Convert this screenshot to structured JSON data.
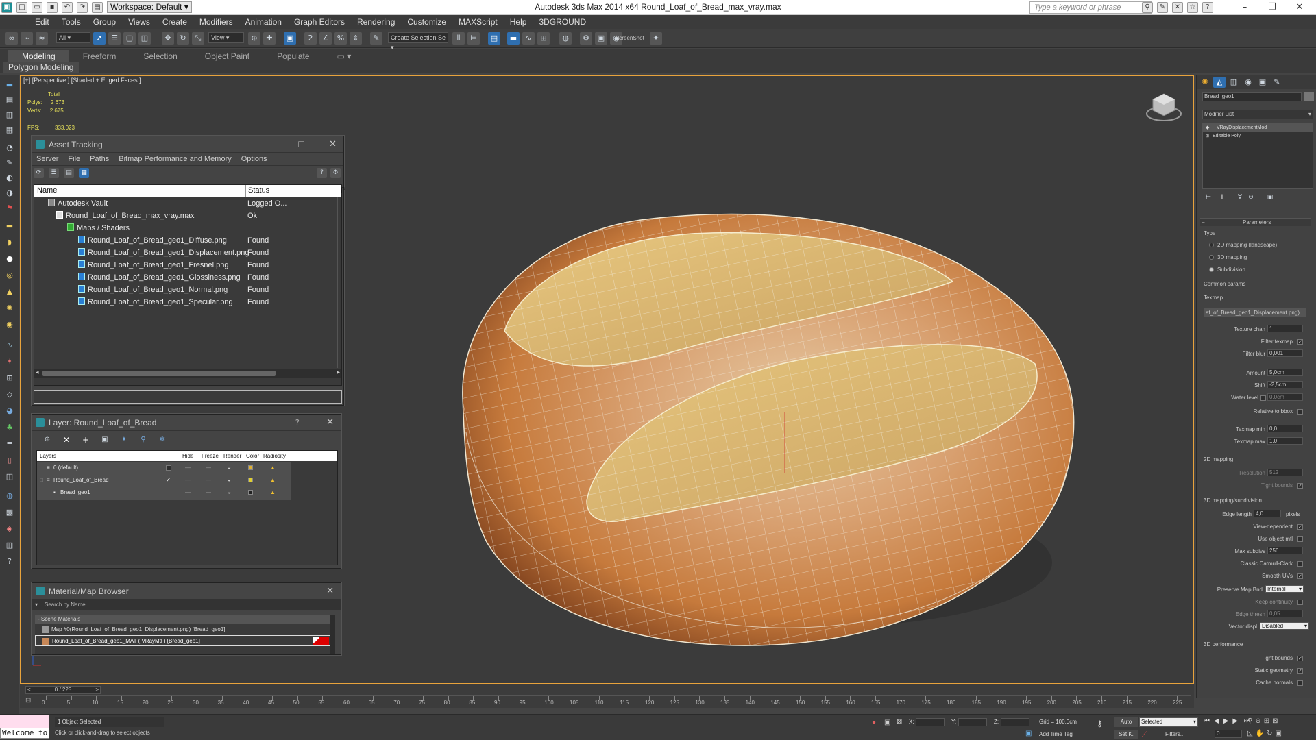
{
  "window": {
    "title": "Autodesk 3ds Max  2014 x64     Round_Loaf_of_Bread_max_vray.max",
    "workspace": "Workspace: Default",
    "search_placeholder": "Type a keyword or phrase"
  },
  "menu": [
    "Edit",
    "Tools",
    "Group",
    "Views",
    "Create",
    "Modifiers",
    "Animation",
    "Graph Editors",
    "Rendering",
    "Customize",
    "MAXScript",
    "Help",
    "3DGROUND"
  ],
  "toolbar": {
    "selection_filter": "All",
    "ref_coord": "View",
    "named_selection": "Create Selection Se",
    "screenshot_label": "ScreenShot"
  },
  "ribbon": {
    "tabs": [
      "Modeling",
      "Freeform",
      "Selection",
      "Object Paint",
      "Populate"
    ],
    "active_tab": "Modeling",
    "sub_label": "Polygon Modeling"
  },
  "viewport": {
    "label": "[+] [Perspective ] [Shaded + Edged Faces ]",
    "stats_header": "Total",
    "polys_label": "Polys:",
    "polys_value": "2 673",
    "verts_label": "Verts:",
    "verts_value": "2 675",
    "fps_label": "FPS:",
    "fps_value": "333,023"
  },
  "asset_tracking": {
    "title": "Asset Tracking",
    "menu": [
      "Server",
      "File",
      "Paths",
      "Bitmap Performance and Memory",
      "Options"
    ],
    "col_name": "Name",
    "col_status": "Status",
    "col_p": "P",
    "rows": [
      {
        "name": "Autodesk Vault",
        "status": "Logged O..."
      },
      {
        "name": "Round_Loaf_of_Bread_max_vray.max",
        "status": "Ok"
      },
      {
        "name": "Maps / Shaders",
        "status": ""
      },
      {
        "name": "Round_Loaf_of_Bread_geo1_Diffuse.png",
        "status": "Found"
      },
      {
        "name": "Round_Loaf_of_Bread_geo1_Displacement.png",
        "status": "Found"
      },
      {
        "name": "Round_Loaf_of_Bread_geo1_Fresnel.png",
        "status": "Found"
      },
      {
        "name": "Round_Loaf_of_Bread_geo1_Glossiness.png",
        "status": "Found"
      },
      {
        "name": "Round_Loaf_of_Bread_geo1_Normal.png",
        "status": "Found"
      },
      {
        "name": "Round_Loaf_of_Bread_geo1_Specular.png",
        "status": "Found"
      }
    ]
  },
  "layer_panel": {
    "title": "Layer: Round_Loaf_of_Bread",
    "help": "?",
    "cols": [
      "Layers",
      "Hide",
      "Freeze",
      "Render",
      "Color",
      "Radiosity"
    ],
    "rows": [
      {
        "name": "0 (default)",
        "color": "#e0b030"
      },
      {
        "name": "Round_Loaf_of_Bread",
        "color": "#e0d030"
      },
      {
        "name": "Bread_geo1",
        "color": "#222222"
      }
    ]
  },
  "material_browser": {
    "title": "Material/Map Browser",
    "search_placeholder": "Search by Name ...",
    "group": "- Scene Materials",
    "items": [
      "Map #0(Round_Loaf_of_Bread_geo1_Displacement.png) [Bread_geo1]",
      "Round_Loaf_of_Bread_geo1_MAT ( VRayMtl ) [Bread_geo1]"
    ]
  },
  "command_panel": {
    "object_name": "Bread_geo1",
    "modifier_list": "Modifier List",
    "stack": [
      "VRayDisplacementMod",
      "Editable Poly"
    ],
    "params_title": "Parameters",
    "type_label": "Type",
    "type_options": [
      "2D mapping (landscape)",
      "3D mapping",
      "Subdivision"
    ],
    "type_selected": 2,
    "common_params": "Common params",
    "texmap_label": "Texmap",
    "texmap_value": "af_of_Bread_geo1_Displacement.png)",
    "texture_chan_label": "Texture chan",
    "texture_chan_value": "1",
    "filter_texmap_label": "Filter texmap",
    "filter_blur_label": "Filter blur",
    "filter_blur_value": "0,001",
    "amount_label": "Amount",
    "amount_value": "5,0cm",
    "shift_label": "Shift",
    "shift_value": "-2,5cm",
    "water_label": "Water level",
    "water_value": "0,0cm",
    "rel_bbox_label": "Relative to bbox",
    "texmap_min_label": "Texmap min",
    "texmap_min_value": "0,0",
    "texmap_max_label": "Texmap max",
    "texmap_max_value": "1,0",
    "mapping2d_title": "2D mapping",
    "resolution_label": "Resolution",
    "resolution_value": "512",
    "tight_bounds_label": "Tight bounds",
    "subdiv_title": "3D mapping/subdivision",
    "edge_length_label": "Edge length",
    "edge_length_value": "4,0",
    "pixels_label": "pixels",
    "view_dependent_label": "View-dependent",
    "use_object_mtl_label": "Use object mtl",
    "max_subdivs_label": "Max subdivs",
    "max_subdivs_value": "256",
    "catmull_label": "Classic Catmull-Clark",
    "smooth_uvs_label": "Smooth UVs",
    "preserve_label": "Preserve Map Bnd",
    "preserve_value": "Internal",
    "keep_cont_label": "Keep continuity",
    "edge_thresh_label": "Edge thresh",
    "edge_thresh_value": "0,05",
    "vector_disp_label": "Vector displ",
    "vector_disp_value": "Disabled",
    "perf_title": "3D performance",
    "perf_tight_label": "Tight bounds",
    "static_geo_label": "Static geometry",
    "cache_normals_label": "Cache normals"
  },
  "timeline": {
    "frame": "0 / 225",
    "ticks": [
      "0",
      "5",
      "10",
      "15",
      "20",
      "25",
      "30",
      "35",
      "40",
      "45",
      "50",
      "55",
      "60",
      "65",
      "70",
      "75",
      "80",
      "85",
      "90",
      "95",
      "100",
      "105",
      "110",
      "115",
      "120",
      "125",
      "130",
      "135",
      "140",
      "145",
      "150",
      "155",
      "160",
      "165",
      "170",
      "175",
      "180",
      "185",
      "190",
      "195",
      "200",
      "205",
      "210",
      "215",
      "220",
      "225"
    ]
  },
  "statusbar": {
    "welcome": "Welcome to",
    "selected": "1 Object Selected",
    "prompt": "Click or click-and-drag to select objects",
    "x_label": "X:",
    "y_label": "Y:",
    "z_label": "Z:",
    "grid": "Grid = 100,0cm",
    "add_time_tag": "Add Time Tag",
    "auto": "Auto",
    "set_key": "Set K.",
    "selected_dropdown": "Selected",
    "filters": "Filters...",
    "frame_value": "0"
  }
}
